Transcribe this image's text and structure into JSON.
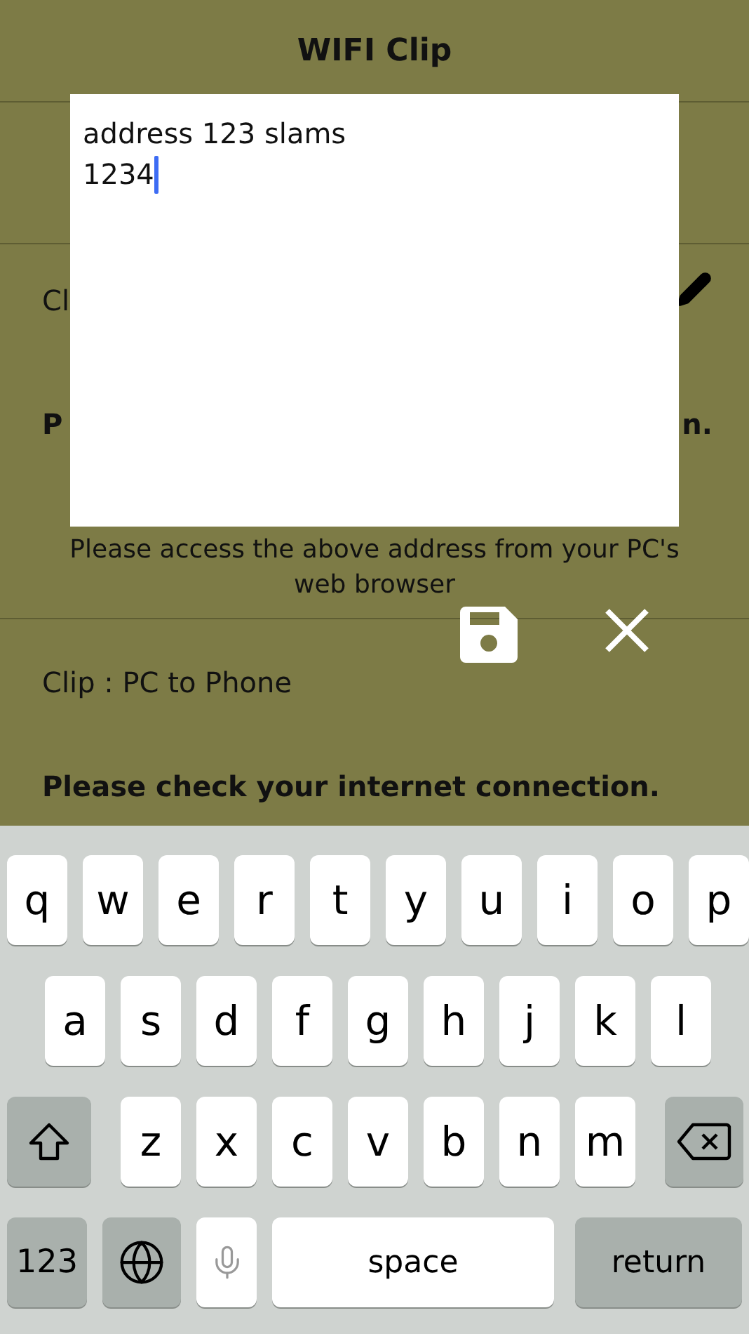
{
  "header": {
    "title": "WIFI Clip"
  },
  "clip_row": {
    "label": "Cl"
  },
  "status_line": {
    "start": "P",
    "end": "n."
  },
  "instruction": "Please access the above address from your PC's web browser",
  "section": {
    "label": "Clip : PC to Phone",
    "message": "Please check your internet connection."
  },
  "editor": {
    "lines": [
      "address 123 slams",
      "1234"
    ],
    "focused": true
  },
  "keyboard": {
    "rows": [
      [
        "q",
        "w",
        "e",
        "r",
        "t",
        "y",
        "u",
        "i",
        "o",
        "p"
      ],
      [
        "a",
        "s",
        "d",
        "f",
        "g",
        "h",
        "j",
        "k",
        "l"
      ],
      [
        "z",
        "x",
        "c",
        "v",
        "b",
        "n",
        "m"
      ]
    ],
    "number_key": "123",
    "space": "space",
    "return": "return"
  }
}
